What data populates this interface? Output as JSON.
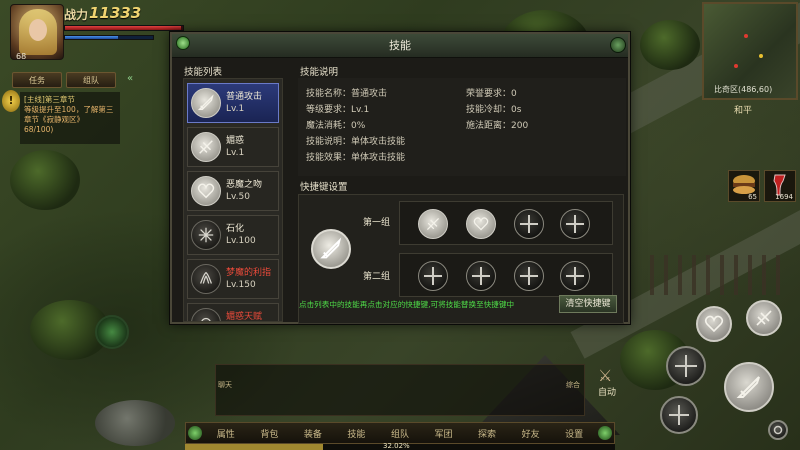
{
  "hud": {
    "power_label": "战力",
    "power_value": "11333",
    "level": "68",
    "hp_fraction": 0.98,
    "mp_fraction": 0.6
  },
  "quest": {
    "tabs": [
      "任务",
      "组队"
    ],
    "title": "[主线]第三章节",
    "desc": "等级提升至100，了解第三章节《寂静观区》",
    "progress": "68/100)"
  },
  "minimap": {
    "coords": "比奇区(486,60)"
  },
  "peace_mode": "和平",
  "items": [
    {
      "count": "65"
    },
    {
      "count": "1694"
    }
  ],
  "auto_label": "自动",
  "chat_tabs": {
    "left": "聊天",
    "right": "综合"
  },
  "bottom_menu": [
    "属性",
    "背包",
    "装备",
    "技能",
    "组队",
    "军团",
    "探索",
    "好友",
    "设置"
  ],
  "exp_text": "32.02%",
  "exp_fraction": 0.3202,
  "dialog": {
    "title": "技能",
    "list_title": "技能列表",
    "info_title": "技能说明",
    "hotkey_title": "快捷键设置",
    "skills": [
      {
        "name": "普通攻击",
        "level": "Lv.1",
        "icon": "sword-icon",
        "active": true
      },
      {
        "name": "媚惑",
        "level": "Lv.1",
        "icon": "charm-icon"
      },
      {
        "name": "恶魔之吻",
        "level": "Lv.50",
        "icon": "heart-icon"
      },
      {
        "name": "石化",
        "level": "Lv.100",
        "icon": "petrify-icon"
      },
      {
        "name": "梦魔的利指",
        "level": "Lv.150",
        "icon": "claw-icon",
        "locked": true
      },
      {
        "name": "媚惑天赋",
        "level": "",
        "icon": "talent-icon",
        "locked": true
      }
    ],
    "info": {
      "name": "技能名称：普通攻击",
      "level_req": "等级要求：Lv.1",
      "mana": "魔法消耗：0%",
      "desc": "技能说明：单体攻击技能",
      "effect": "技能效果：单体攻击技能",
      "honor": "荣誉要求：0",
      "cooldown": "技能冷却：0s",
      "range": "施法距离：200"
    },
    "group1_label": "第一组",
    "group2_label": "第二组",
    "hint": "点击列表中的技能再点击对应的快捷键,可将技能替换至快捷键中",
    "clear_button": "清空快捷键"
  },
  "colors": {
    "accent_green": "#4fdc48",
    "locked_red": "#e84a3a",
    "active_blue": "#2c3a7a"
  }
}
